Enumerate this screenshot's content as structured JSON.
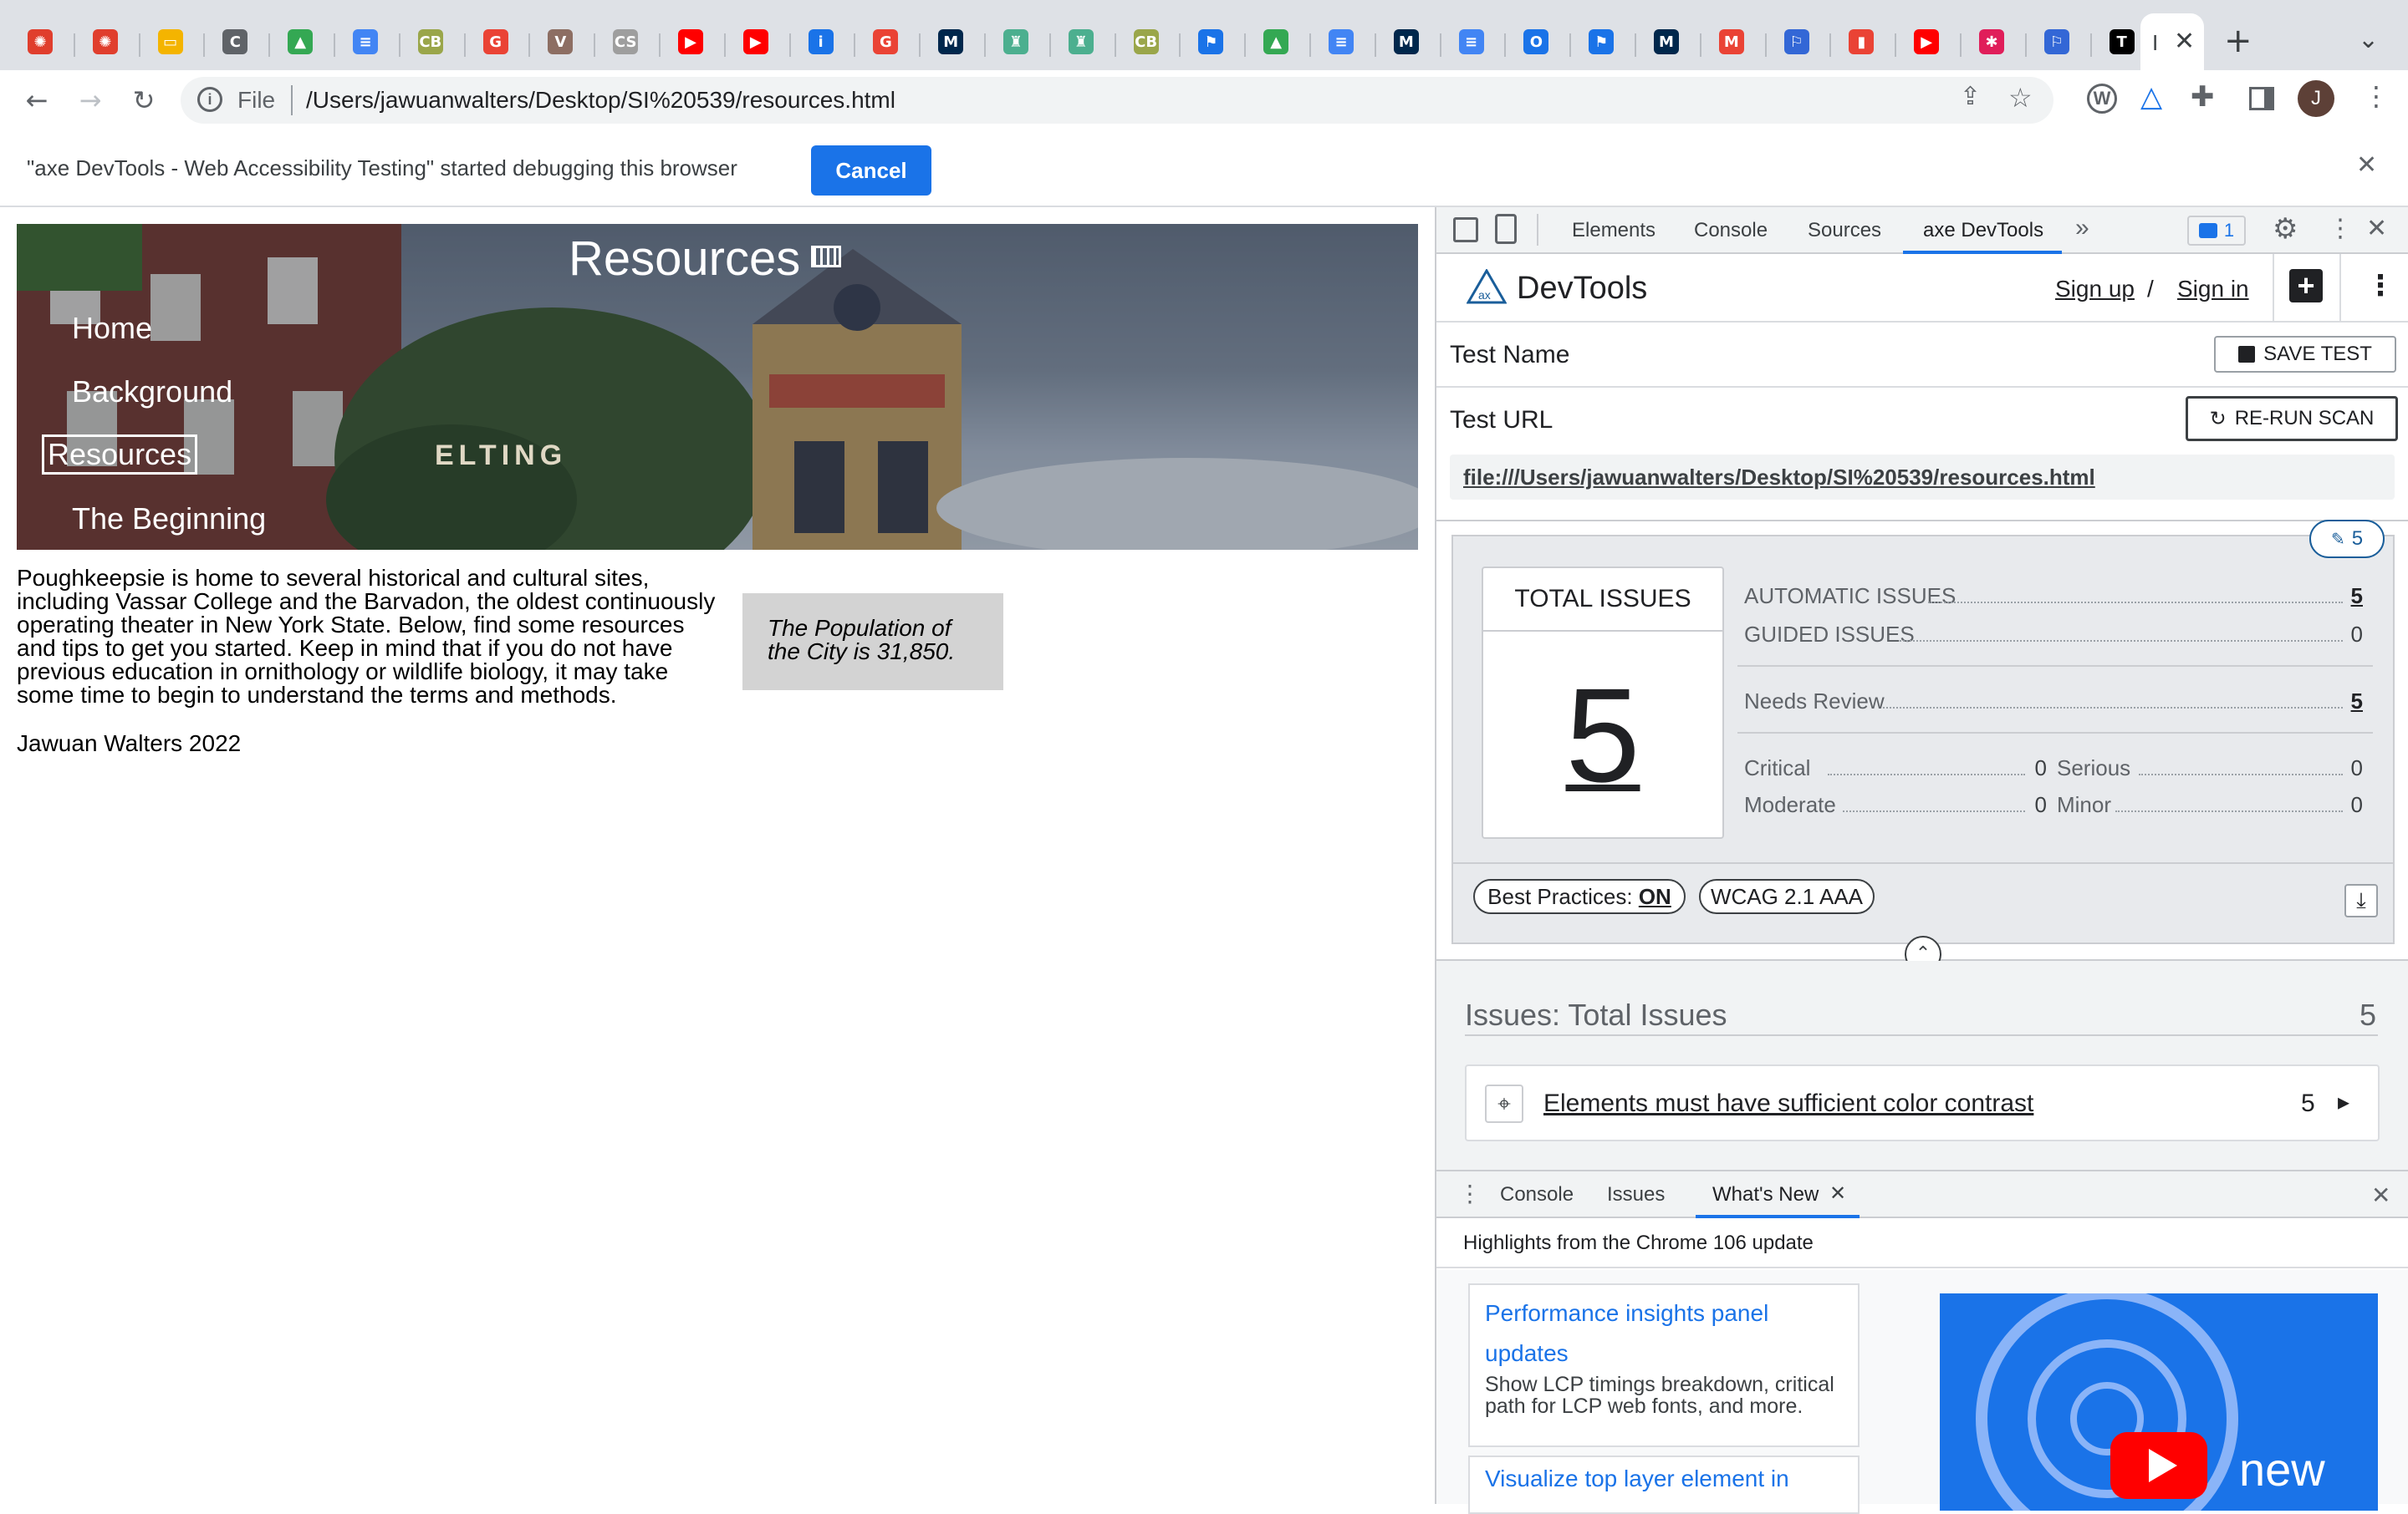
{
  "browser": {
    "active_tab_title": "I",
    "address": {
      "scheme_label": "File",
      "url": "/Users/jawuanwalters/Desktop/SI%20539/resources.html"
    },
    "profile_initial": "J",
    "tab_icons": [
      {
        "name": "canvas-icon",
        "color": "#e03e2d",
        "glyph": "✺"
      },
      {
        "name": "canvas-icon",
        "color": "#e03e2d",
        "glyph": "✺"
      },
      {
        "name": "slides-icon",
        "color": "#f4b400",
        "glyph": "▭"
      },
      {
        "name": "doc-c-icon",
        "color": "#5f6368",
        "glyph": "C"
      },
      {
        "name": "drive-icon",
        "color": "#34a853",
        "glyph": "▲"
      },
      {
        "name": "docs-icon",
        "color": "#4285f4",
        "glyph": "≡"
      },
      {
        "name": "cb-icon",
        "color": "#9aa64a",
        "glyph": "CB"
      },
      {
        "name": "google-icon",
        "color": "#ea4335",
        "glyph": "G"
      },
      {
        "name": "v-icon",
        "color": "#8d6e63",
        "glyph": "V"
      },
      {
        "name": "csis-icon",
        "color": "#9e9e9e",
        "glyph": "CS"
      },
      {
        "name": "youtube-icon",
        "color": "#ff0000",
        "glyph": "▶"
      },
      {
        "name": "youtube-icon",
        "color": "#ff0000",
        "glyph": "▶"
      },
      {
        "name": "info-icon",
        "color": "#1a73e8",
        "glyph": "i"
      },
      {
        "name": "google-icon",
        "color": "#ea4335",
        "glyph": "G"
      },
      {
        "name": "umich-icon",
        "color": "#00274c",
        "glyph": "M"
      },
      {
        "name": "liberty-icon",
        "color": "#4caf8f",
        "glyph": "♜"
      },
      {
        "name": "liberty-icon",
        "color": "#4caf8f",
        "glyph": "♜"
      },
      {
        "name": "cb-icon",
        "color": "#9aa64a",
        "glyph": "CB"
      },
      {
        "name": "flag-icon",
        "color": "#1a73e8",
        "glyph": "⚑"
      },
      {
        "name": "drive-icon",
        "color": "#34a853",
        "glyph": "▲"
      },
      {
        "name": "docs-icon",
        "color": "#4285f4",
        "glyph": "≡"
      },
      {
        "name": "umich-icon",
        "color": "#00274c",
        "glyph": "M"
      },
      {
        "name": "docs-icon",
        "color": "#4285f4",
        "glyph": "≡"
      },
      {
        "name": "opera-icon",
        "color": "#1a73e8",
        "glyph": "O"
      },
      {
        "name": "flag-icon",
        "color": "#1a73e8",
        "glyph": "⚑"
      },
      {
        "name": "umich-icon",
        "color": "#00274c",
        "glyph": "M"
      },
      {
        "name": "gmail-icon",
        "color": "#ea4335",
        "glyph": "M"
      },
      {
        "name": "flag-icon",
        "color": "#3367d6",
        "glyph": "⚐"
      },
      {
        "name": "bag-icon",
        "color": "#ea4335",
        "glyph": "▮"
      },
      {
        "name": "youtube-icon",
        "color": "#ff0000",
        "glyph": "▶"
      },
      {
        "name": "slack-icon",
        "color": "#e01e5a",
        "glyph": "✱"
      },
      {
        "name": "flag-icon",
        "color": "#3367d6",
        "glyph": "⚐"
      },
      {
        "name": "nyt-icon",
        "color": "#000000",
        "glyph": "T"
      }
    ]
  },
  "debug_bar": {
    "message": "\"axe DevTools - Web Accessibility Testing\" started debugging this browser",
    "cancel_label": "Cancel"
  },
  "page": {
    "title": "Resources",
    "nav": [
      "Home",
      "Background",
      "Resources",
      "The Beginning"
    ],
    "hero_sign": "ELTING",
    "paragraph": "Poughkeepsie is home to several historical and cultural sites, including Vassar College and the Barvadon, the oldest continuously operating theater in New York State. Below, find some resources and tips to get you started. Keep in mind that if you do not have previous education in ornithology or wildlife biology, it may take some time to begin to understand the terms and methods.",
    "aside": "The Population of the City is 31,850.",
    "footer": "Jawuan Walters 2022"
  },
  "devtools": {
    "tabs": [
      "Elements",
      "Console",
      "Sources",
      "axe DevTools"
    ],
    "issues_badge": "1",
    "axe": {
      "brand": "DevTools",
      "brand_mark": "ax",
      "sign_up": "Sign up",
      "separator": "/",
      "sign_in": "Sign in",
      "test_name_label": "Test Name",
      "save_test": "SAVE TEST",
      "test_url_label": "Test URL",
      "rerun_scan": "RE-RUN SCAN",
      "test_url": "file:///Users/jawuanwalters/Desktop/SI%20539/resources.html",
      "edit_badge": "5",
      "total_issues_label": "TOTAL ISSUES",
      "total_issues": "5",
      "automatic_label": "AUTOMATIC ISSUES",
      "automatic_value": "5",
      "guided_label": "GUIDED ISSUES",
      "guided_value": "0",
      "needs_review_label": "Needs Review",
      "needs_review_value": "5",
      "critical_label": "Critical",
      "critical_value": "0",
      "serious_label": "Serious",
      "serious_value": "0",
      "moderate_label": "Moderate",
      "moderate_value": "0",
      "minor_label": "Minor",
      "minor_value": "0",
      "best_practices_label": "Best Practices:",
      "best_practices_value": "ON",
      "standard": "WCAG 2.1 AAA",
      "issues_header": "Issues: Total Issues",
      "issues_count": "5",
      "issue_title": "Elements must have sufficient color contrast",
      "issue_count": "5"
    },
    "drawer": {
      "tabs": [
        "Console",
        "Issues",
        "What's New"
      ],
      "highlights": "Highlights from the Chrome 106 update",
      "card1_title": "Performance insights panel updates",
      "card1_desc": "Show LCP timings breakdown, critical path for LCP web fonts, and more.",
      "card2_title": "Visualize top layer element in",
      "video_label": "new"
    }
  }
}
